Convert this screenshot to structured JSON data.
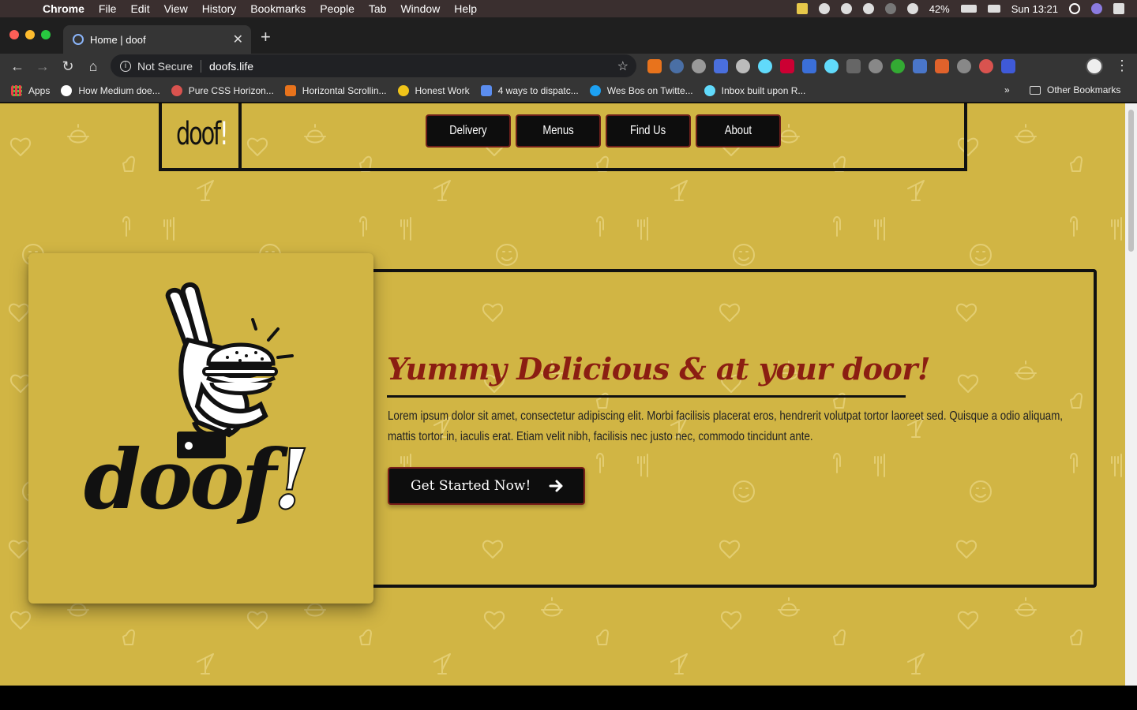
{
  "menubar": {
    "app": "Chrome",
    "items": [
      "File",
      "Edit",
      "View",
      "History",
      "Bookmarks",
      "People",
      "Tab",
      "Window",
      "Help"
    ],
    "battery": "42%",
    "clock": "Sun 13:21"
  },
  "tab": {
    "title": "Home | doof"
  },
  "omnibox": {
    "security": "Not Secure",
    "url": "doofs.life"
  },
  "bookmarks": {
    "items": [
      {
        "label": "Apps",
        "color": "#4285f4"
      },
      {
        "label": "How Medium doe...",
        "color": "#ffffff"
      },
      {
        "label": "Pure CSS Horizon...",
        "color": "#d9534f"
      },
      {
        "label": "Horizontal Scrollin...",
        "color": "#e8731c"
      },
      {
        "label": "Honest Work",
        "color": "#f0c419"
      },
      {
        "label": "4 ways to dispatc...",
        "color": "#5b8def"
      },
      {
        "label": "Wes Bos on Twitte...",
        "color": "#1da1f2"
      },
      {
        "label": "Inbox built upon R...",
        "color": "#61dafb"
      }
    ],
    "more": "»",
    "other": "Other Bookmarks"
  },
  "site": {
    "logo_text": "doof",
    "logo_bang": "!",
    "nav": [
      "Delivery",
      "Menus",
      "Find Us",
      "About"
    ],
    "hero_title": "Yummy Delicious & at your door!",
    "hero_text": "Lorem ipsum dolor sit amet, consectetur adipiscing elit. Morbi facilisis placerat eros, hendrerit volutpat tortor laoreet sed. Quisque a odio aliquam, mattis tortor in, iaculis erat. Etiam velit nibh, facilisis nec justo nec, commodo tincidunt ante.",
    "cta": "Get Started Now!",
    "card_logo_text": "doof",
    "card_logo_bang": "!"
  },
  "colors": {
    "page_bg": "#d1b544",
    "title_red": "#8b1e12",
    "button_bg": "#0d0d0d",
    "button_border": "#6d1e1a"
  }
}
